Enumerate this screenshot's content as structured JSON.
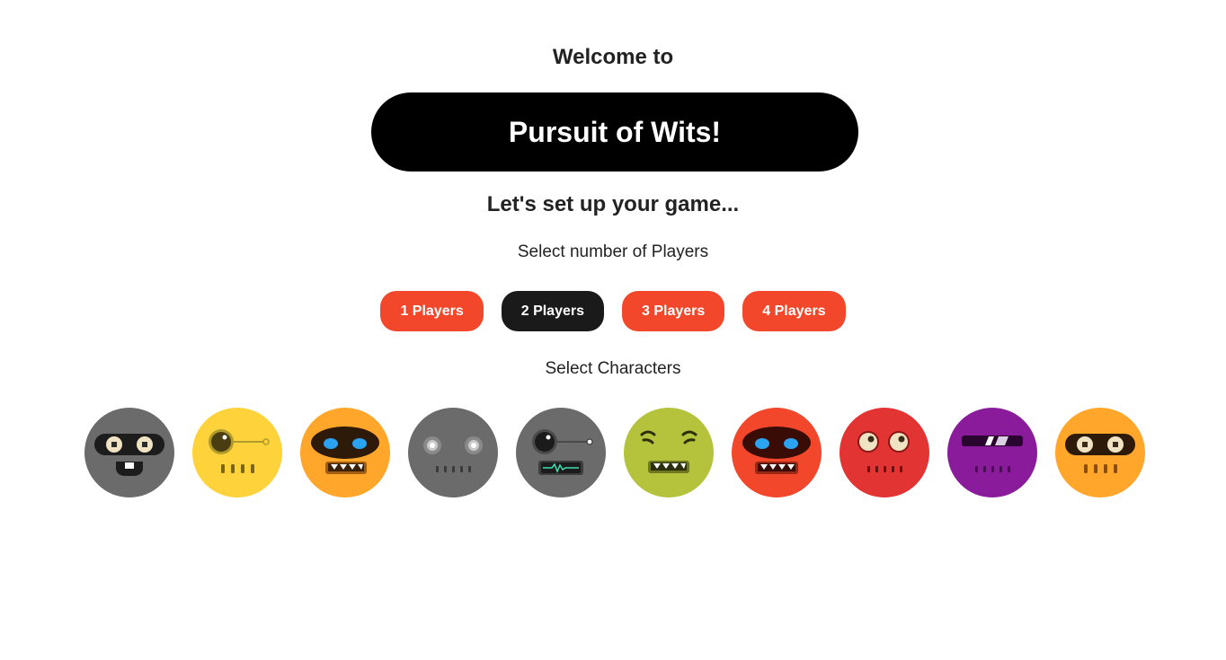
{
  "header": {
    "welcome": "Welcome to",
    "title": "Pursuit of Wits!",
    "subtitle": "Let's set up your game..."
  },
  "players": {
    "label": "Select number of Players",
    "options": [
      "1 Players",
      "2 Players",
      "3 Players",
      "4 Players"
    ],
    "selected": "2 Players"
  },
  "characters": {
    "label": "Select Characters",
    "items": [
      {
        "icon": "masked-robot-face-icon",
        "color": "#6b6b6b"
      },
      {
        "icon": "monocle-robot-face-icon",
        "color": "#fdd23a"
      },
      {
        "icon": "visor-robot-face-icon",
        "color": "#ffa62b"
      },
      {
        "icon": "glow-eyes-robot-face-icon",
        "color": "#6b6b6b"
      },
      {
        "icon": "heartbeat-robot-face-icon",
        "color": "#6b6b6b"
      },
      {
        "icon": "squint-robot-face-icon",
        "color": "#b5c33c"
      },
      {
        "icon": "visor-robot-face-icon",
        "color": "#f2472a"
      },
      {
        "icon": "goggle-eyes-robot-face-icon",
        "color": "#e33434"
      },
      {
        "icon": "slit-visor-robot-face-icon",
        "color": "#8a1c9c"
      },
      {
        "icon": "masked-robot-face-icon",
        "color": "#ffa62b"
      }
    ]
  },
  "colors": {
    "accent": "#f2472a",
    "selected": "#1a1a1a",
    "banner": "#000000"
  }
}
